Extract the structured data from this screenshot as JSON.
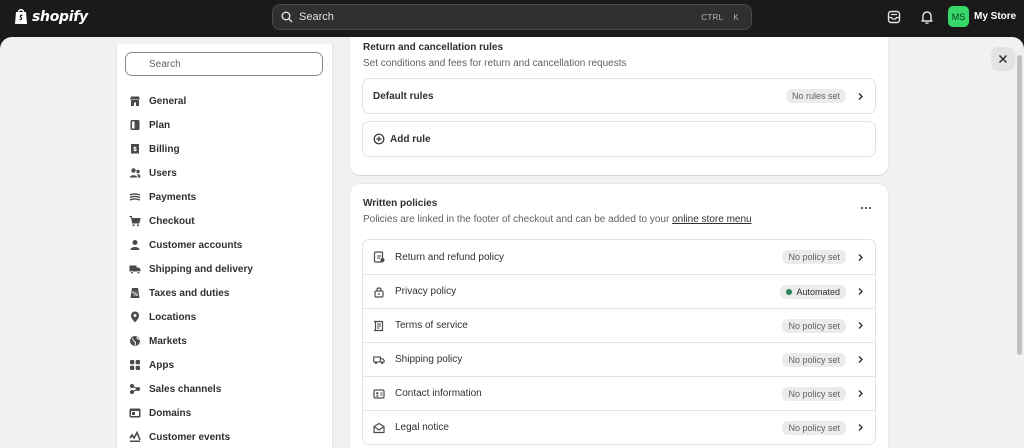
{
  "topbar": {
    "logo_text": "shopify",
    "search_placeholder": "Search",
    "shortcut_ctrl": "CTRL",
    "shortcut_key": "K",
    "avatar_initials": "MS",
    "store_name": "My Store",
    "avatar_color": "#36d86a"
  },
  "sidebar": {
    "search_placeholder": "Search",
    "items": [
      {
        "label": "General",
        "icon": "store-icon"
      },
      {
        "label": "Plan",
        "icon": "plan-icon"
      },
      {
        "label": "Billing",
        "icon": "billing-icon"
      },
      {
        "label": "Users",
        "icon": "users-icon"
      },
      {
        "label": "Payments",
        "icon": "payments-icon"
      },
      {
        "label": "Checkout",
        "icon": "cart-icon"
      },
      {
        "label": "Customer accounts",
        "icon": "person-icon"
      },
      {
        "label": "Shipping and delivery",
        "icon": "truck-icon"
      },
      {
        "label": "Taxes and duties",
        "icon": "tax-icon"
      },
      {
        "label": "Locations",
        "icon": "location-icon"
      },
      {
        "label": "Markets",
        "icon": "globe-icon"
      },
      {
        "label": "Apps",
        "icon": "apps-icon"
      },
      {
        "label": "Sales channels",
        "icon": "channels-icon"
      },
      {
        "label": "Domains",
        "icon": "domains-icon"
      },
      {
        "label": "Customer events",
        "icon": "events-icon"
      }
    ]
  },
  "returns_card": {
    "title": "Return and cancellation rules",
    "description": "Set conditions and fees for return and cancellation requests",
    "default_rules_label": "Default rules",
    "default_rules_badge": "No rules set",
    "add_rule_label": "Add rule"
  },
  "policies_card": {
    "title": "Written policies",
    "description": "Policies are linked in the footer of checkout and can be added to your",
    "link_text": "online store menu",
    "policies": [
      {
        "label": "Return and refund policy",
        "status": "No policy set",
        "icon": "return-policy-icon"
      },
      {
        "label": "Privacy policy",
        "status": "Automated",
        "icon": "lock-icon"
      },
      {
        "label": "Terms of service",
        "status": "No policy set",
        "icon": "terms-icon"
      },
      {
        "label": "Shipping policy",
        "status": "No policy set",
        "icon": "truck-icon"
      },
      {
        "label": "Contact information",
        "status": "No policy set",
        "icon": "contact-card-icon"
      },
      {
        "label": "Legal notice",
        "status": "No policy set",
        "icon": "envelope-icon"
      }
    ],
    "automated_dot_color": "#29845a"
  }
}
